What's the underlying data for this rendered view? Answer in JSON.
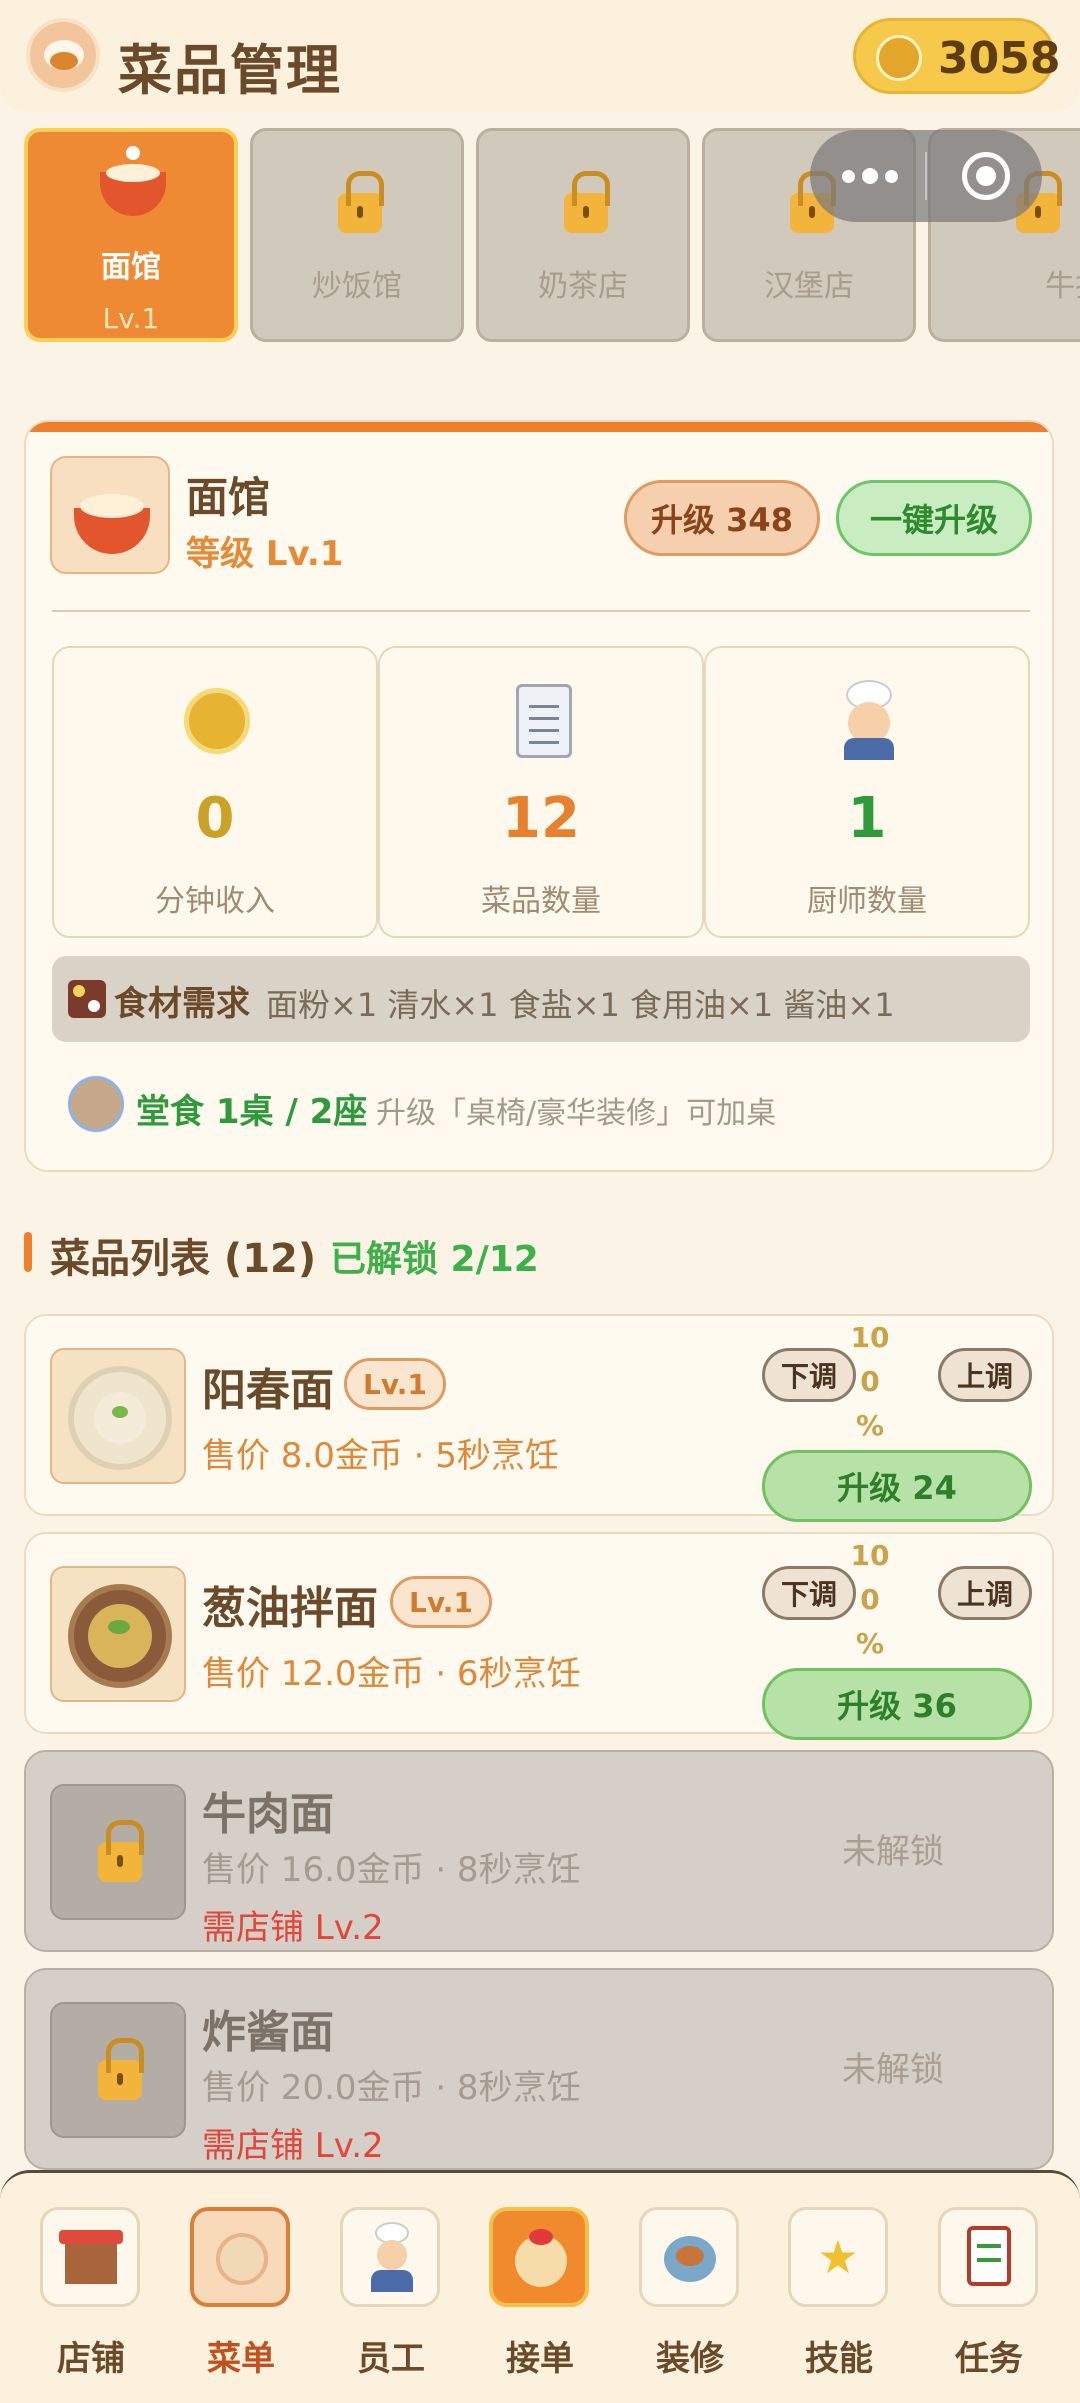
{
  "header": {
    "title": "菜品管理",
    "coins": "3058"
  },
  "shops": [
    {
      "name": "面馆",
      "level": "Lv.1",
      "locked": false
    },
    {
      "name": "炒饭馆",
      "locked": true
    },
    {
      "name": "奶茶店",
      "locked": true
    },
    {
      "name": "汉堡店",
      "locked": true
    },
    {
      "name": "牛排店",
      "locked": true
    }
  ],
  "shop_info": {
    "name": "面馆",
    "level": "等级 Lv.1",
    "upgrade_label": "升级 348",
    "one_click_label": "一键升级",
    "stats": [
      {
        "value": "0",
        "caption": "分钟收入",
        "icon": "gold-coin-icon"
      },
      {
        "value": "12",
        "caption": "菜品数量",
        "icon": "menu-clipboard-icon"
      },
      {
        "value": "1",
        "caption": "厨师数量",
        "icon": "chef-icon"
      }
    ],
    "ingredients_title": "食材需求",
    "ingredients": "面粉×1 清水×1 食盐×1 食用油×1 酱油×1",
    "dine_in": "堂食 1桌 / 2座",
    "dine_hint": "升级「桌椅/豪华装修」可加桌"
  },
  "dish_list": {
    "title": "菜品列表 (12)",
    "unlocked": "已解锁 2/12"
  },
  "dishes": [
    {
      "name": "阳春面",
      "level": "Lv.1",
      "meta": "售价 8.0金币 · 5秒烹饪",
      "down": "下调",
      "up": "上调",
      "pct": [
        "10",
        "0",
        "%"
      ],
      "upgrade": "升级 24"
    },
    {
      "name": "葱油拌面",
      "level": "Lv.1",
      "meta": "售价 12.0金币 · 6秒烹饪",
      "down": "下调",
      "up": "上调",
      "pct": [
        "10",
        "0",
        "%"
      ],
      "upgrade": "升级 36"
    },
    {
      "name": "牛肉面",
      "meta": "售价 16.0金币 · 8秒烹饪",
      "need": "需店铺 Lv.2",
      "status": "未解锁"
    },
    {
      "name": "炸酱面",
      "meta": "售价 20.0金币 · 8秒烹饪",
      "need": "需店铺 Lv.2",
      "status": "未解锁"
    }
  ],
  "nav": [
    {
      "label": "店铺",
      "icon": "shop-icon"
    },
    {
      "label": "菜单",
      "icon": "menu-icon"
    },
    {
      "label": "员工",
      "icon": "staff-icon"
    },
    {
      "label": "接单",
      "icon": "order-icon"
    },
    {
      "label": "装修",
      "icon": "decor-icon"
    },
    {
      "label": "技能",
      "icon": "skill-star-icon"
    },
    {
      "label": "任务",
      "icon": "task-icon"
    }
  ],
  "colors": {
    "accent": "#ef7f2a",
    "green": "#3eb04a",
    "gold": "#c9a227"
  }
}
